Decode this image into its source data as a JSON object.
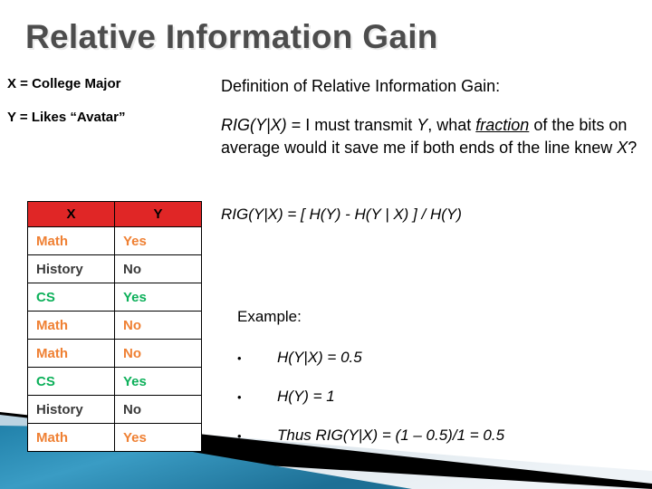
{
  "slide": {
    "title": "Relative Information Gain",
    "legend": {
      "x": "X = College Major",
      "y": "Y = Likes “Avatar”"
    },
    "table": {
      "headers": [
        "X",
        "Y"
      ],
      "rows": [
        {
          "x": "Math",
          "y": "Yes",
          "color": "orange"
        },
        {
          "x": "History",
          "y": "No",
          "color": "dark"
        },
        {
          "x": "CS",
          "y": "Yes",
          "color": "green"
        },
        {
          "x": "Math",
          "y": "No",
          "color": "orange"
        },
        {
          "x": "Math",
          "y": "No",
          "color": "orange"
        },
        {
          "x": "CS",
          "y": "Yes",
          "color": "green"
        },
        {
          "x": "History",
          "y": "No",
          "color": "dark"
        },
        {
          "x": "Math",
          "y": "Yes",
          "color": "orange"
        }
      ]
    },
    "definition": {
      "heading": "Definition of Relative Information Gain:",
      "paragraph_parts": {
        "p1": "RIG(Y|X)",
        "p2": " = I must transmit ",
        "p3": "Y",
        "p4": ", what ",
        "p5": "fraction",
        "p6": " of the bits on average would it save me if both ends of the line knew ",
        "p7": "X",
        "p8": "?"
      },
      "formula": "RIG(Y|X) = [ H(Y) - H(Y | X) ] / H(Y)"
    },
    "example": {
      "heading": "Example:",
      "bullet_marker": "•",
      "bullets": [
        "H(Y|X) = 0.5",
        "H(Y) = 1",
        "Thus RIG(Y|X) = (1 – 0.5)/1 = 0.5"
      ]
    },
    "colors": {
      "title": "#4d4d4d",
      "header_red": "#e02626",
      "orange": "#ef8033",
      "green": "#0db05a",
      "dark": "#3a3a3a",
      "ribbon_teal": "#2e90b8",
      "ribbon_light": "#dfe9ef"
    }
  }
}
